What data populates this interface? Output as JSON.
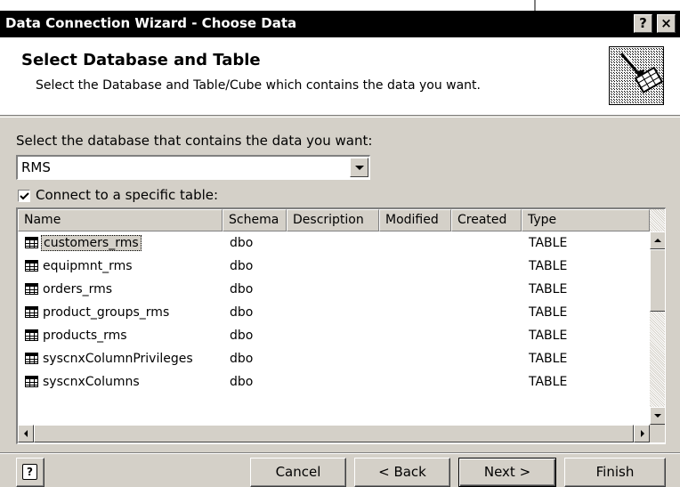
{
  "window": {
    "title": "Data Connection Wizard - Choose Data",
    "help_button": "?",
    "close_button": "×"
  },
  "header": {
    "title": "Select Database and Table",
    "subtitle": "Select the Database and Table/Cube which contains the data you want."
  },
  "database": {
    "label": "Select the database that contains the data you want:",
    "value": "RMS"
  },
  "connect_checkbox": {
    "label": "Connect to a specific table:",
    "checked": true
  },
  "table": {
    "columns": [
      "Name",
      "Schema",
      "Description",
      "Modified",
      "Created",
      "Type"
    ],
    "rows": [
      {
        "name": "customers_rms",
        "schema": "dbo",
        "description": "",
        "modified": "",
        "created": "",
        "type": "TABLE",
        "selected": true
      },
      {
        "name": "equipmnt_rms",
        "schema": "dbo",
        "description": "",
        "modified": "",
        "created": "",
        "type": "TABLE"
      },
      {
        "name": "orders_rms",
        "schema": "dbo",
        "description": "",
        "modified": "",
        "created": "",
        "type": "TABLE"
      },
      {
        "name": "product_groups_rms",
        "schema": "dbo",
        "description": "",
        "modified": "",
        "created": "",
        "type": "TABLE"
      },
      {
        "name": "products_rms",
        "schema": "dbo",
        "description": "",
        "modified": "",
        "created": "",
        "type": "TABLE"
      },
      {
        "name": "syscnxColumnPrivileges",
        "schema": "dbo",
        "description": "",
        "modified": "",
        "created": "",
        "type": "TABLE"
      },
      {
        "name": "syscnxColumns",
        "schema": "dbo",
        "description": "",
        "modified": "",
        "created": "",
        "type": "TABLE"
      }
    ]
  },
  "buttons": {
    "help": "?",
    "cancel": "Cancel",
    "back": "< Back",
    "next": "Next >",
    "finish": "Finish"
  }
}
